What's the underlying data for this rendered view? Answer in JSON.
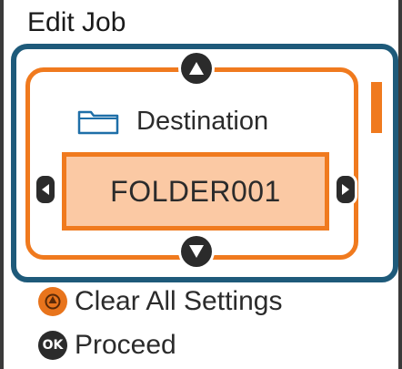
{
  "screen": {
    "title": "Edit Job"
  },
  "setting": {
    "icon": "folder-icon",
    "label": "Destination",
    "value": "FOLDER001"
  },
  "actions": {
    "clear": {
      "label": "Clear All Settings",
      "icon": "reset-icon"
    },
    "proceed": {
      "label": "Proceed",
      "icon_text": "OK",
      "icon": "ok-icon"
    }
  },
  "colors": {
    "accent": "#f07a1e",
    "value_fill": "#fbc9a4",
    "focus": "#1e5a7a",
    "button": "#2b2b2b",
    "reset_button": "#e8741c"
  }
}
